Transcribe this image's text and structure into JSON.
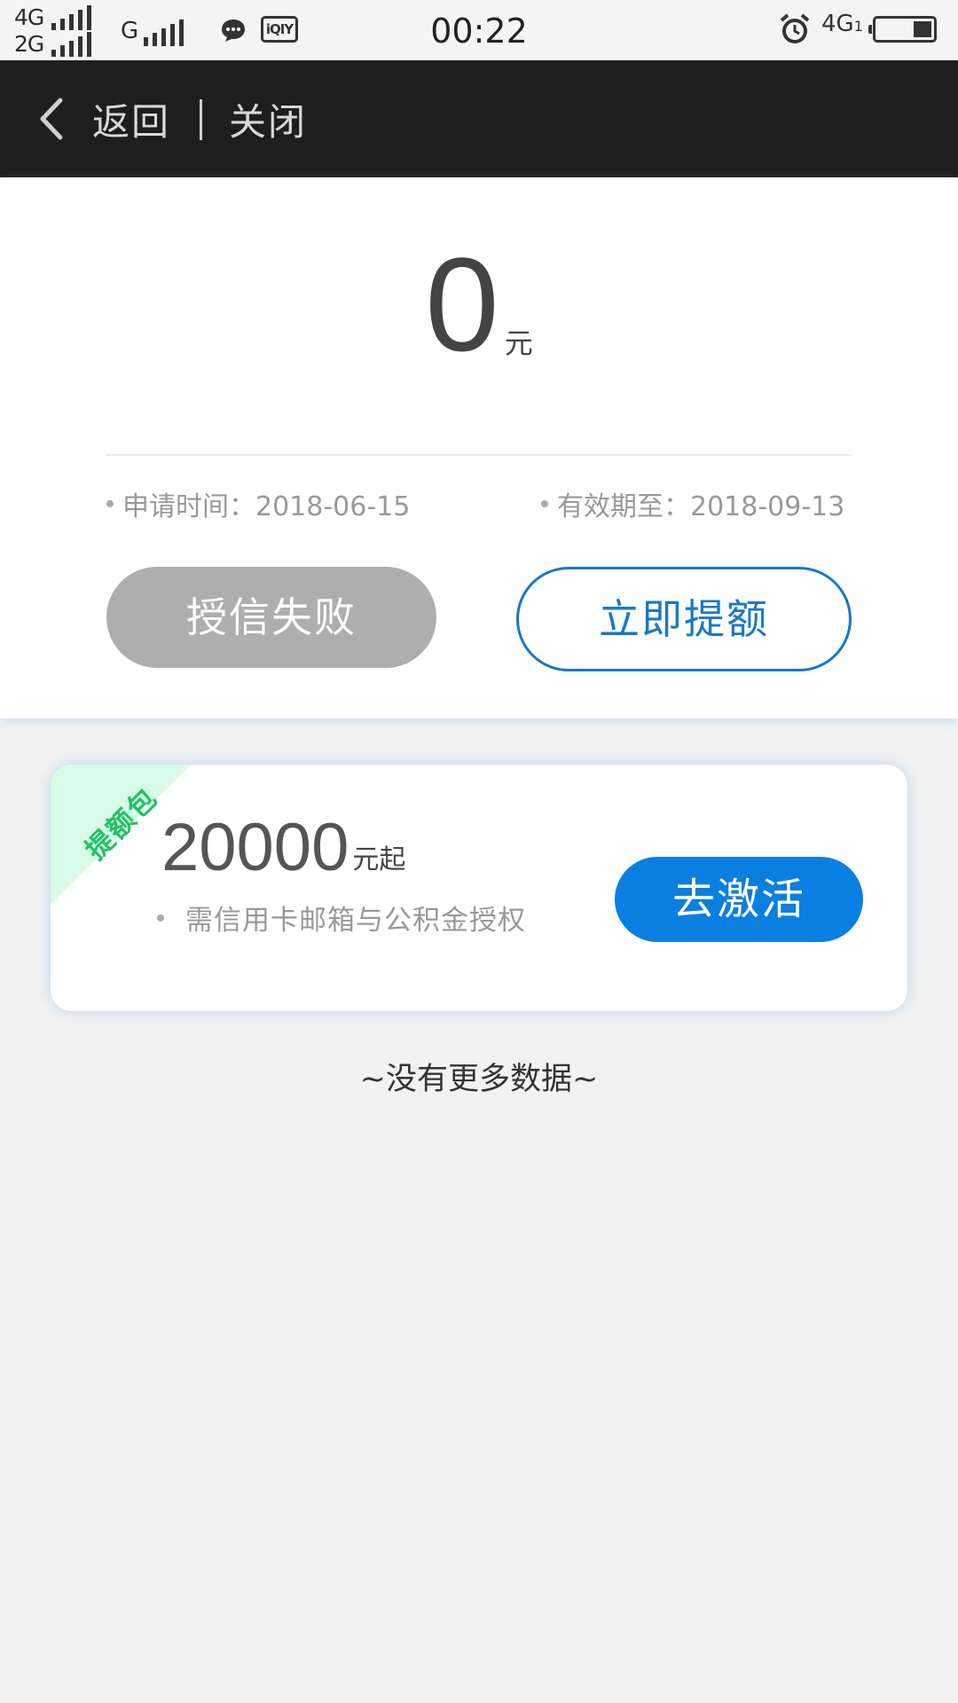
{
  "status_bar": {
    "net1": "4G",
    "net2": "2G",
    "net3": "G",
    "app_icon": "iQIY",
    "time": "00:22",
    "net_right": "4G",
    "net_right_sub": "1",
    "icons": [
      "signal-icon",
      "chat-icon",
      "iqiyi-icon",
      "alarm-icon",
      "battery-icon"
    ]
  },
  "nav": {
    "back_label": "返回",
    "close_label": "关闭"
  },
  "credit": {
    "amount": "0",
    "unit": "元",
    "apply_time": "申请时间：2018-06-15",
    "valid_until": "有效期至：2018-09-13",
    "status_button": "授信失败",
    "raise_button": "立即提额"
  },
  "package": {
    "ribbon": "提额包",
    "amount": "20000",
    "unit": "元起",
    "description": "需信用卡邮箱与公积金授权",
    "activate_button": "去激活"
  },
  "footer": {
    "no_more": "~没有更多数据~"
  },
  "colors": {
    "nav_bg": "#1e1e1e",
    "accent_blue": "#0a7fe2",
    "outline_blue": "#1978c8",
    "disabled_gray": "#aeaeae",
    "ribbon_green": "#21c363"
  }
}
